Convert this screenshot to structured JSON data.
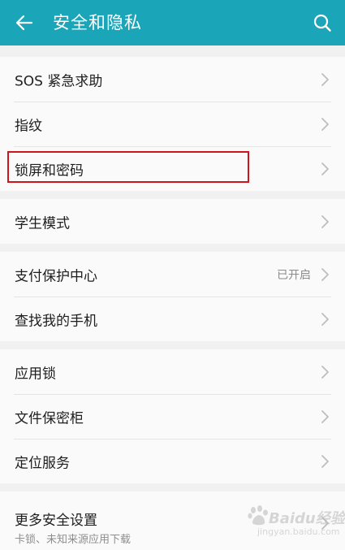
{
  "header": {
    "title": "安全和隐私",
    "back_icon": "arrow-left-icon",
    "search_icon": "search-icon"
  },
  "groups": [
    {
      "items": [
        {
          "label": "SOS 紧急求助"
        },
        {
          "label": "指纹"
        },
        {
          "label": "锁屏和密码"
        }
      ]
    },
    {
      "items": [
        {
          "label": "学生模式"
        }
      ]
    },
    {
      "items": [
        {
          "label": "支付保护中心",
          "status": "已开启"
        },
        {
          "label": "查找我的手机"
        }
      ]
    },
    {
      "items": [
        {
          "label": "应用锁"
        },
        {
          "label": "文件保密柜"
        },
        {
          "label": "定位服务"
        }
      ]
    },
    {
      "items": [
        {
          "label": "更多安全设置",
          "subtitle": "卡锁、未知来源应用下载"
        }
      ]
    }
  ],
  "watermark": {
    "text": "Baidu经验",
    "sub": "jingyan.baidu.com"
  },
  "colors": {
    "app_bar": "#1aa5b8",
    "highlight": "#d0141c"
  }
}
